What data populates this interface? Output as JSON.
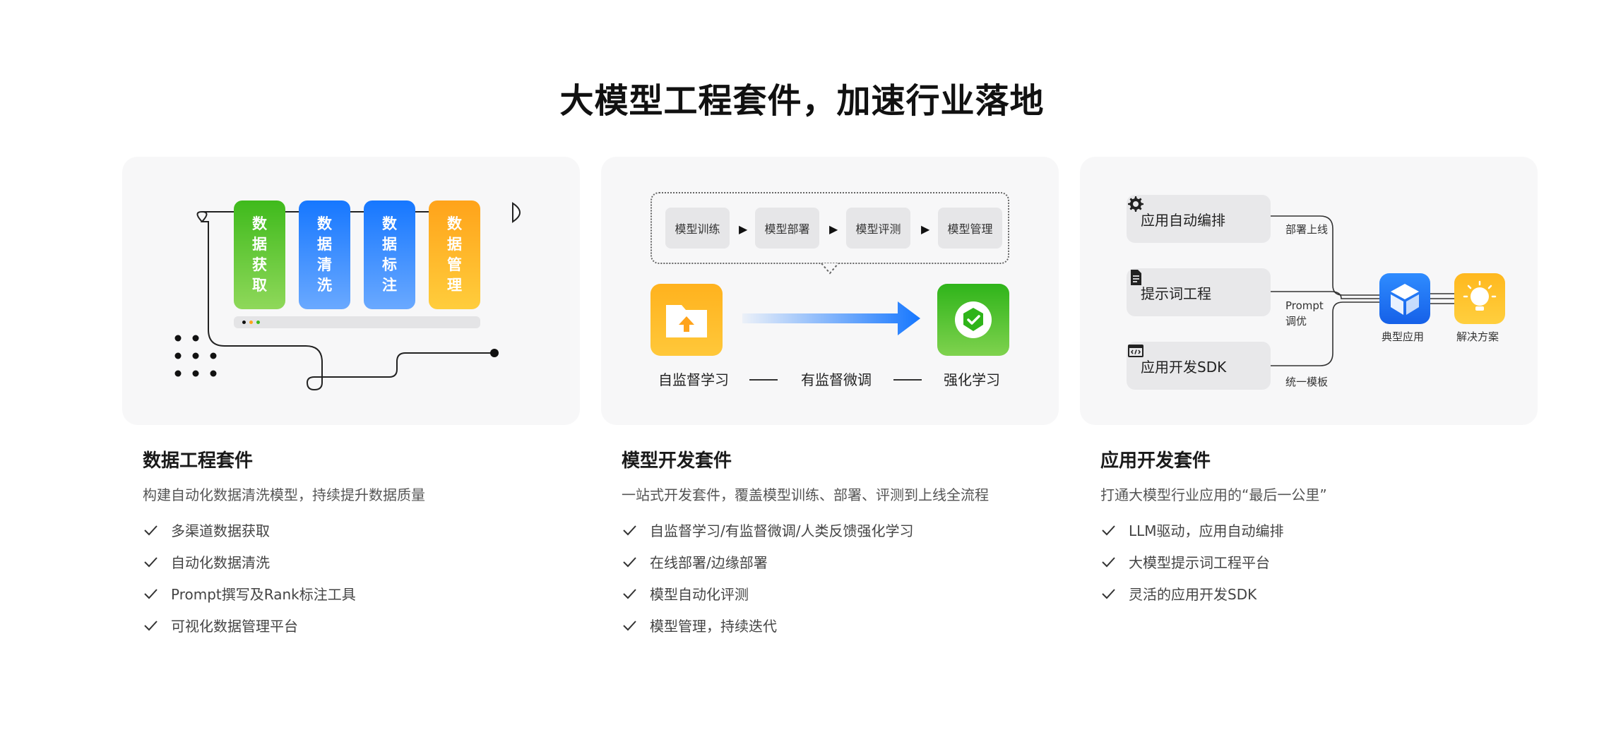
{
  "title": "大模型工程套件，加速行业落地",
  "panel1": {
    "stages": [
      {
        "chars": [
          "数",
          "据",
          "获",
          "取"
        ]
      },
      {
        "chars": [
          "数",
          "据",
          "清",
          "洗"
        ]
      },
      {
        "chars": [
          "数",
          "据",
          "标",
          "注"
        ]
      },
      {
        "chars": [
          "数",
          "据",
          "管",
          "理"
        ]
      }
    ]
  },
  "panel2": {
    "flow": [
      "模型训练",
      "模型部署",
      "模型评测",
      "模型管理"
    ],
    "arrow_glyph": "▶",
    "labels": [
      "自监督学习",
      "有监督微调",
      "强化学习"
    ]
  },
  "panel3": {
    "chips": [
      "应用自动编排",
      "提示词工程",
      "应用开发SDK"
    ],
    "connector_labels": {
      "deploy": "部署上线",
      "prompt_1": "Prompt",
      "prompt_2": "调优",
      "template": "统一模板"
    },
    "typical_app": "典型应用",
    "solution": "解决方案"
  },
  "columns": [
    {
      "title": "数据工程套件",
      "desc": "构建自动化数据清洗模型，持续提升数据质量",
      "items": [
        "多渠道数据获取",
        "自动化数据清洗",
        "Prompt撰写及Rank标注工具",
        "可视化数据管理平台"
      ]
    },
    {
      "title": "模型开发套件",
      "desc": "一站式开发套件，覆盖模型训练、部署、评测到上线全流程",
      "items": [
        "自监督学习/有监督微调/人类反馈强化学习",
        "在线部署/边缘部署",
        "模型自动化评测",
        "模型管理，持续迭代"
      ]
    },
    {
      "title": "应用开发套件",
      "desc": "打通大模型行业应用的“最后一公里”",
      "items": [
        "LLM驱动，应用自动编排",
        "大模型提示词工程平台",
        "灵活的应用开发SDK"
      ]
    }
  ],
  "colors": {
    "green": "#3fba1c",
    "blue": "#1677ff",
    "orange": "#ffa31a"
  }
}
